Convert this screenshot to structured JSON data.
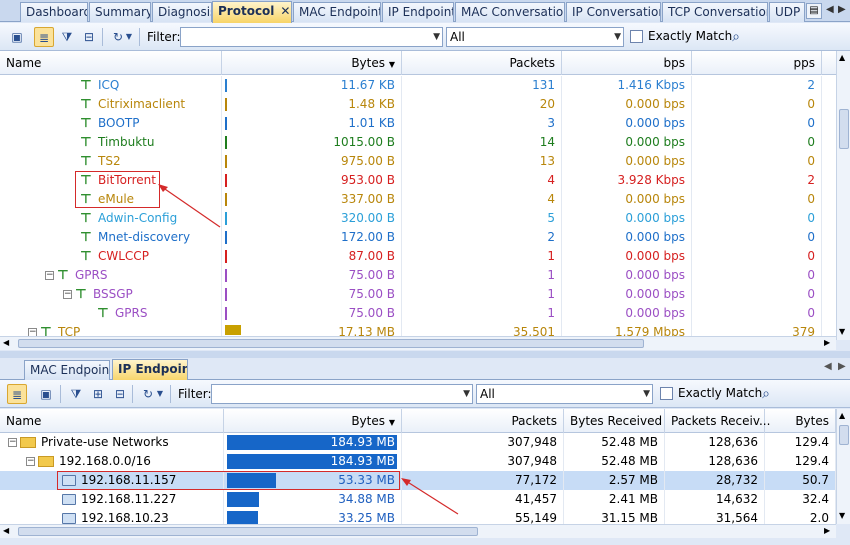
{
  "tabs": {
    "items": [
      {
        "label": "Dashboard"
      },
      {
        "label": "Summary"
      },
      {
        "label": "Diagnosis"
      },
      {
        "label": "Protocol"
      },
      {
        "label": "MAC Endpoint"
      },
      {
        "label": "IP Endpoint"
      },
      {
        "label": "MAC Conversation"
      },
      {
        "label": "IP Conversation"
      },
      {
        "label": "TCP Conversation"
      },
      {
        "label": "UDP"
      }
    ],
    "close_glyph": "✕"
  },
  "top": {
    "filter_label": "Filter:",
    "filter_value": "",
    "scope": "All",
    "exact_label": "Exactly Match",
    "columns": {
      "name": "Name",
      "bytes": "Bytes",
      "packets": "Packets",
      "bps": "bps",
      "pps": "pps"
    },
    "rows": [
      {
        "name": "ICQ",
        "bytes": "11.67 KB",
        "packets": "131",
        "bps": "1.416 Kbps",
        "pps": "2",
        "color": "#2b7fd0",
        "bar": "#2b7fd0"
      },
      {
        "name": "Citriximaclient",
        "bytes": "1.48 KB",
        "packets": "20",
        "bps": "0.000 bps",
        "pps": "0",
        "color": "#b8860b",
        "bar": "#b8860b"
      },
      {
        "name": "BOOTP",
        "bytes": "1.01 KB",
        "packets": "3",
        "bps": "0.000 bps",
        "pps": "0",
        "color": "#1e6fc9",
        "bar": "#1e6fc9"
      },
      {
        "name": "Timbuktu",
        "bytes": "1015.00 B",
        "packets": "14",
        "bps": "0.000 bps",
        "pps": "0",
        "color": "#1e7d1e",
        "bar": "#1e7d1e"
      },
      {
        "name": "TS2",
        "bytes": "975.00 B",
        "packets": "13",
        "bps": "0.000 bps",
        "pps": "0",
        "color": "#b8860b",
        "bar": "#b8860b"
      },
      {
        "name": "BitTorrent",
        "bytes": "953.00 B",
        "packets": "4",
        "bps": "3.928 Kbps",
        "pps": "2",
        "color": "#d62020",
        "bar": "#d62020"
      },
      {
        "name": "eMule",
        "bytes": "337.00 B",
        "packets": "4",
        "bps": "0.000 bps",
        "pps": "0",
        "color": "#b8860b",
        "bar": "#b8860b"
      },
      {
        "name": "Adwin-Config",
        "bytes": "320.00 B",
        "packets": "5",
        "bps": "0.000 bps",
        "pps": "0",
        "color": "#2b9fd8",
        "bar": "#2b9fd8"
      },
      {
        "name": "Mnet-discovery",
        "bytes": "172.00 B",
        "packets": "2",
        "bps": "0.000 bps",
        "pps": "0",
        "color": "#1e6fc9",
        "bar": "#1e6fc9"
      },
      {
        "name": "CWLCCP",
        "bytes": "87.00 B",
        "packets": "1",
        "bps": "0.000 bps",
        "pps": "0",
        "color": "#d62020",
        "bar": "#d62020"
      },
      {
        "name": "GPRS",
        "bytes": "75.00 B",
        "packets": "1",
        "bps": "0.000 bps",
        "pps": "0",
        "color": "#9b4fc4",
        "bar": "#9b4fc4"
      },
      {
        "name": "BSSGP",
        "bytes": "75.00 B",
        "packets": "1",
        "bps": "0.000 bps",
        "pps": "0",
        "color": "#9b4fc4",
        "bar": "#9b4fc4"
      },
      {
        "name": "GPRS",
        "bytes": "75.00 B",
        "packets": "1",
        "bps": "0.000 bps",
        "pps": "0",
        "color": "#9b4fc4",
        "bar": "#9b4fc4"
      },
      {
        "name": "TCP",
        "bytes": "17.13 MB",
        "packets": "35,501",
        "bps": "1.579 Mbps",
        "pps": "379",
        "color": "#b8860b",
        "bar": "#c8a000"
      }
    ]
  },
  "bottom": {
    "tabs": [
      {
        "label": "MAC Endpoint"
      },
      {
        "label": "IP Endpoint"
      }
    ],
    "filter_label": "Filter:",
    "filter_value": "",
    "scope": "All",
    "exact_label": "Exactly Match",
    "columns": {
      "name": "Name",
      "bytes": "Bytes",
      "packets": "Packets",
      "bytes_received": "Bytes Received",
      "packets_received": "Packets Receiv...",
      "bytes_sent": "Bytes"
    },
    "rows": [
      {
        "name": "Private-use Networks",
        "bytes": "184.93 MB",
        "bar": 1.0,
        "packets": "307,948",
        "bytes_received": "52.48 MB",
        "packets_received": "128,636",
        "bytes_sent": "129.4"
      },
      {
        "name": "192.168.0.0/16",
        "bytes": "184.93 MB",
        "bar": 1.0,
        "packets": "307,948",
        "bytes_received": "52.48 MB",
        "packets_received": "128,636",
        "bytes_sent": "129.4"
      },
      {
        "name": "192.168.11.157",
        "bytes": "53.33 MB",
        "bar": 0.29,
        "packets": "77,172",
        "bytes_received": "2.57 MB",
        "packets_received": "28,732",
        "bytes_sent": "50.7"
      },
      {
        "name": "192.168.11.227",
        "bytes": "34.88 MB",
        "bar": 0.19,
        "packets": "41,457",
        "bytes_received": "2.41 MB",
        "packets_received": "14,632",
        "bytes_sent": "32.4"
      },
      {
        "name": "192.168.10.23",
        "bytes": "33.25 MB",
        "bar": 0.18,
        "packets": "55,149",
        "bytes_received": "31.15 MB",
        "packets_received": "31,564",
        "bytes_sent": "2.0"
      }
    ]
  }
}
